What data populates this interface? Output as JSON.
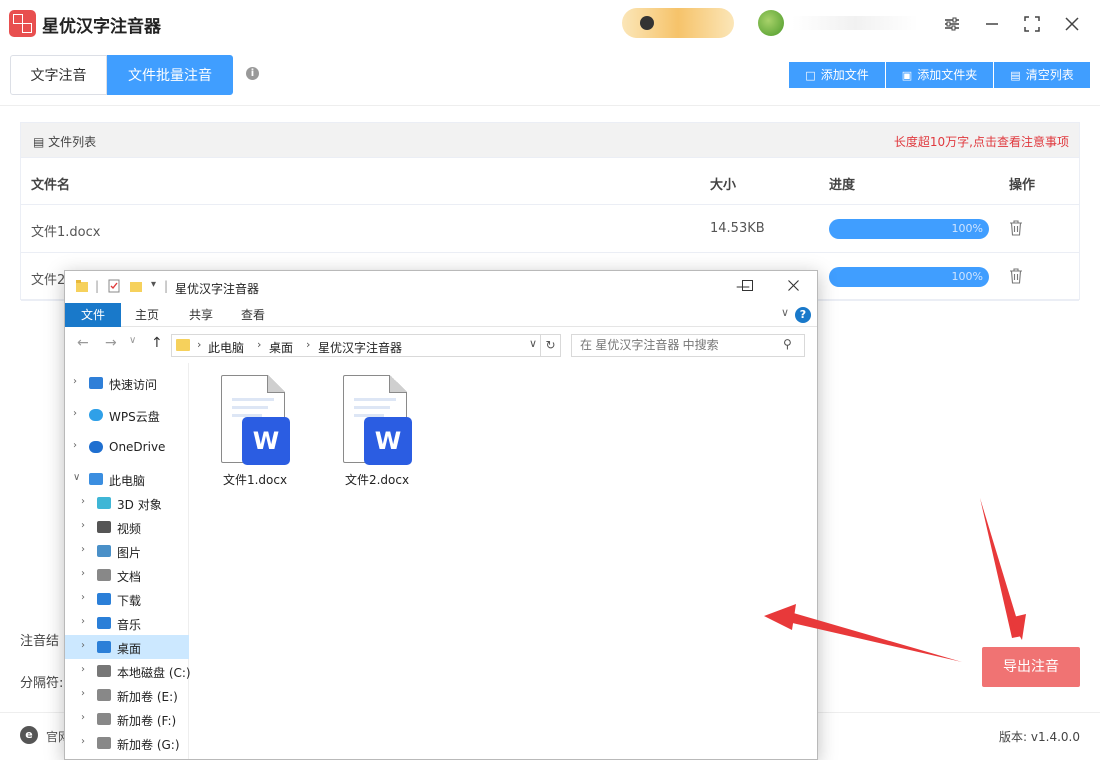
{
  "app": {
    "title": "星优汉字注音器"
  },
  "tabs": [
    {
      "label": "文字注音",
      "active": false
    },
    {
      "label": "文件批量注音",
      "active": true
    }
  ],
  "toolbar": {
    "add_file": "添加文件",
    "add_folder": "添加文件夹",
    "clear_list": "清空列表"
  },
  "file_list": {
    "header": "文件列表",
    "notice": "长度超10万字,点击查看注意事项",
    "columns": {
      "name": "文件名",
      "size": "大小",
      "progress": "进度",
      "action": "操作"
    },
    "rows": [
      {
        "name": "文件1.docx",
        "size": "14.53KB",
        "progress": "100%"
      },
      {
        "name": "文件2",
        "size": "",
        "progress": "100%"
      }
    ]
  },
  "settings": {
    "result_label": "注音结",
    "separator_label": "分隔符:"
  },
  "export_button": "导出注音",
  "footer": {
    "site": "官网",
    "version": "版本: v1.4.0.0"
  },
  "explorer": {
    "title": "星优汉字注音器",
    "ribbon": {
      "file": "文件",
      "home": "主页",
      "share": "共享",
      "view": "查看"
    },
    "address": [
      "此电脑",
      "桌面",
      "星优汉字注音器"
    ],
    "search_placeholder": "在 星优汉字注音器 中搜索",
    "tree": [
      {
        "label": "快速访问",
        "icon": "star-icon"
      },
      {
        "label": "WPS云盘",
        "icon": "cloud-icon"
      },
      {
        "label": "OneDrive",
        "icon": "onedrive-icon"
      },
      {
        "label": "此电脑",
        "icon": "pc-icon"
      },
      {
        "label": "3D 对象",
        "icon": "cube-icon"
      },
      {
        "label": "视频",
        "icon": "video-icon"
      },
      {
        "label": "图片",
        "icon": "picture-icon"
      },
      {
        "label": "文档",
        "icon": "document-icon"
      },
      {
        "label": "下载",
        "icon": "download-icon"
      },
      {
        "label": "音乐",
        "icon": "music-icon"
      },
      {
        "label": "桌面",
        "icon": "desktop-icon"
      },
      {
        "label": "本地磁盘 (C:)",
        "icon": "disk-icon"
      },
      {
        "label": "新加卷 (E:)",
        "icon": "drive-icon"
      },
      {
        "label": "新加卷 (F:)",
        "icon": "drive-icon"
      },
      {
        "label": "新加卷 (G:)",
        "icon": "drive-icon"
      }
    ],
    "files": [
      {
        "name": "文件1.docx",
        "badge": "W"
      },
      {
        "name": "文件2.docx",
        "badge": "W"
      }
    ]
  },
  "colors": {
    "accent": "#409eff",
    "export": "#f07373",
    "notice": "#e0393e",
    "explorer_accent": "#1979ca",
    "word_badge": "#2b5de2"
  }
}
